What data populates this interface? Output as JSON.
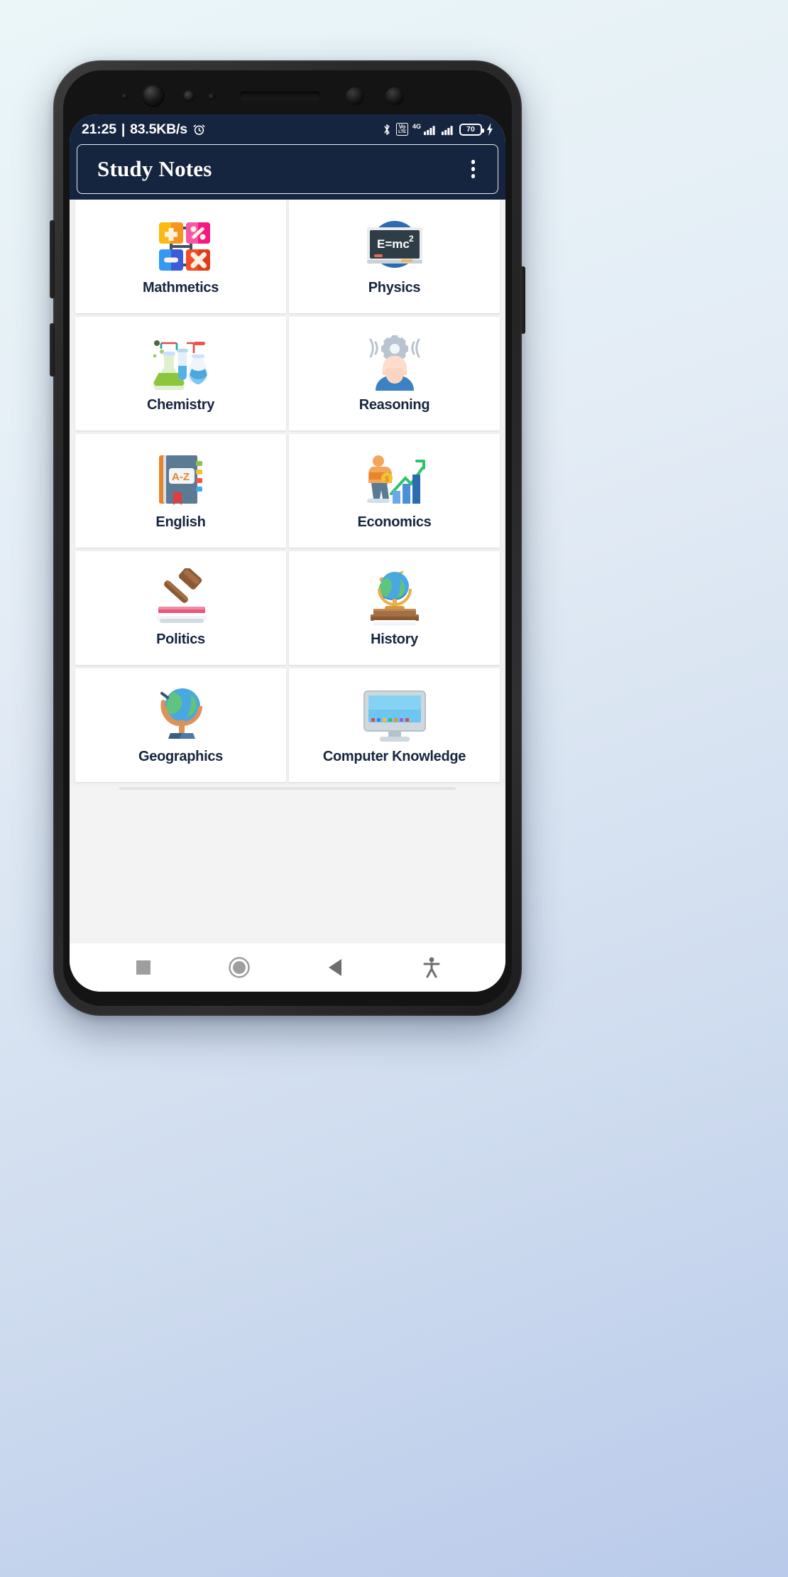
{
  "device": {
    "name": "android-phone",
    "frame_color": "#2a2a2a"
  },
  "status_bar": {
    "background": "#16253f",
    "time": "21:25",
    "separator": "|",
    "network_speed": "83.5KB/s",
    "alarm_icon": "alarm-clock-icon",
    "icons": [
      "bluetooth-icon",
      "volte-icon",
      "4g-icon",
      "signal-bars-sim1-icon",
      "signal-bars-sim2-icon"
    ],
    "network_label": "4G",
    "volte_label": "Vo",
    "volte_sub": "LTE",
    "battery_percent": "70",
    "charging_icon": "charging-bolt-icon"
  },
  "app_bar": {
    "title": "Study Notes",
    "background": "#16253f",
    "overflow_icon": "overflow-menu-icon"
  },
  "content": {
    "accent_text_color": "#16253f",
    "items": [
      {
        "label": "Mathmetics",
        "icon": "mathematics-icon"
      },
      {
        "label": "Physics",
        "icon": "physics-blackboard-icon"
      },
      {
        "label": "Chemistry",
        "icon": "chemistry-flasks-icon"
      },
      {
        "label": "Reasoning",
        "icon": "reasoning-head-gear-icon"
      },
      {
        "label": "English",
        "icon": "english-dictionary-book-icon"
      },
      {
        "label": "Economics",
        "icon": "economics-growth-chart-icon"
      },
      {
        "label": "Politics",
        "icon": "politics-gavel-icon"
      },
      {
        "label": "History",
        "icon": "history-globe-books-icon"
      },
      {
        "label": "Geographics",
        "icon": "geographics-globe-icon"
      },
      {
        "label": "Computer Knowledge",
        "icon": "computer-monitor-icon"
      }
    ]
  },
  "nav_bar": {
    "buttons": [
      {
        "name": "recents-button",
        "icon": "square-icon"
      },
      {
        "name": "home-button",
        "icon": "circle-icon"
      },
      {
        "name": "back-button",
        "icon": "triangle-left-icon"
      },
      {
        "name": "accessibility-button",
        "icon": "accessibility-icon"
      }
    ]
  }
}
